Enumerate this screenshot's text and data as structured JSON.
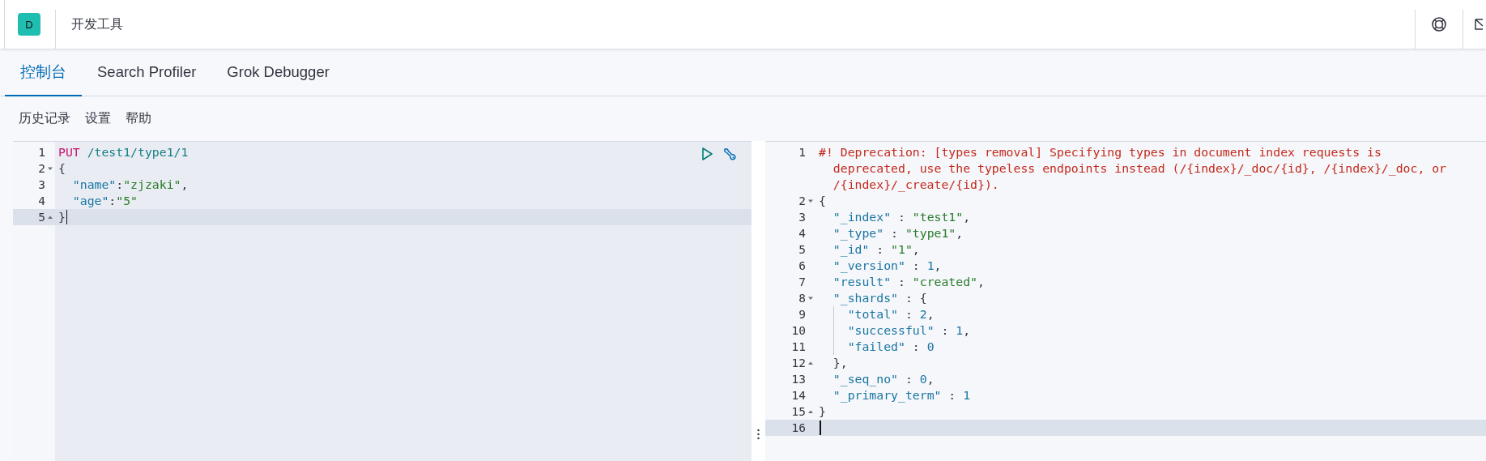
{
  "header": {
    "logo": "D",
    "title": "开发工具"
  },
  "tabs": [
    {
      "label": "控制台",
      "selected": true
    },
    {
      "label": "Search Profiler",
      "selected": false
    },
    {
      "label": "Grok Debugger",
      "selected": false
    }
  ],
  "menu": [
    "历史记录",
    "设置",
    "帮助"
  ],
  "request": {
    "lines": [
      {
        "number": "1",
        "fold_open": false,
        "fold_close": false,
        "active": false,
        "wrap": false,
        "guide": false,
        "tokens": [
          {
            "kind": "method",
            "text": "PUT"
          },
          {
            "kind": "url",
            "text": " /test1/type1/1"
          }
        ]
      },
      {
        "number": "2",
        "fold_open": true,
        "fold_close": false,
        "active": false,
        "wrap": false,
        "guide": false,
        "tokens": [
          {
            "kind": "punct",
            "text": "{"
          }
        ]
      },
      {
        "number": "3",
        "fold_open": false,
        "fold_close": false,
        "active": false,
        "wrap": false,
        "guide": false,
        "tokens": [
          {
            "kind": "key",
            "text": "  \"name\""
          },
          {
            "kind": "punct",
            "text": ":"
          },
          {
            "kind": "string",
            "text": "\"zjzaki\""
          },
          {
            "kind": "punct",
            "text": ","
          }
        ]
      },
      {
        "number": "4",
        "fold_open": false,
        "fold_close": false,
        "active": false,
        "wrap": false,
        "guide": false,
        "tokens": [
          {
            "kind": "key",
            "text": "  \"age\""
          },
          {
            "kind": "punct",
            "text": ":"
          },
          {
            "kind": "string",
            "text": "\"5\""
          }
        ]
      },
      {
        "number": "5",
        "fold_open": false,
        "fold_close": true,
        "active": true,
        "wrap": false,
        "guide": false,
        "tokens": [
          {
            "kind": "punct",
            "text": "}"
          }
        ]
      }
    ]
  },
  "response": {
    "lines": [
      {
        "number": "1",
        "fold_open": false,
        "fold_close": false,
        "active": false,
        "wrap": false,
        "guide": false,
        "tokens": [
          {
            "kind": "comment",
            "text": "#! Deprecation: [types removal] Specifying types in document index requests is"
          }
        ]
      },
      {
        "fold_open": false,
        "fold_close": false,
        "active": false,
        "wrap": true,
        "guide": false,
        "tokens": [
          {
            "kind": "comment",
            "text": "deprecated, use the typeless endpoints instead (/{index}/_doc/{id}, /{index}/_doc, or"
          }
        ]
      },
      {
        "fold_open": false,
        "fold_close": false,
        "active": false,
        "wrap": true,
        "guide": false,
        "tokens": [
          {
            "kind": "comment",
            "text": "/{index}/_create/{id})."
          }
        ]
      },
      {
        "number": "2",
        "fold_open": true,
        "fold_close": false,
        "active": false,
        "wrap": false,
        "guide": false,
        "tokens": [
          {
            "kind": "punct",
            "text": "{"
          }
        ]
      },
      {
        "number": "3",
        "fold_open": false,
        "fold_close": false,
        "active": false,
        "wrap": false,
        "guide": false,
        "tokens": [
          {
            "kind": "key",
            "text": "  \"_index\""
          },
          {
            "kind": "punct",
            "text": " : "
          },
          {
            "kind": "string",
            "text": "\"test1\""
          },
          {
            "kind": "punct",
            "text": ","
          }
        ]
      },
      {
        "number": "4",
        "fold_open": false,
        "fold_close": false,
        "active": false,
        "wrap": false,
        "guide": false,
        "tokens": [
          {
            "kind": "key",
            "text": "  \"_type\""
          },
          {
            "kind": "punct",
            "text": " : "
          },
          {
            "kind": "string",
            "text": "\"type1\""
          },
          {
            "kind": "punct",
            "text": ","
          }
        ]
      },
      {
        "number": "5",
        "fold_open": false,
        "fold_close": false,
        "active": false,
        "wrap": false,
        "guide": false,
        "tokens": [
          {
            "kind": "key",
            "text": "  \"_id\""
          },
          {
            "kind": "punct",
            "text": " : "
          },
          {
            "kind": "string",
            "text": "\"1\""
          },
          {
            "kind": "punct",
            "text": ","
          }
        ]
      },
      {
        "number": "6",
        "fold_open": false,
        "fold_close": false,
        "active": false,
        "wrap": false,
        "guide": false,
        "tokens": [
          {
            "kind": "key",
            "text": "  \"_version\""
          },
          {
            "kind": "punct",
            "text": " : "
          },
          {
            "kind": "number",
            "text": "1"
          },
          {
            "kind": "punct",
            "text": ","
          }
        ]
      },
      {
        "number": "7",
        "fold_open": false,
        "fold_close": false,
        "active": false,
        "wrap": false,
        "guide": false,
        "tokens": [
          {
            "kind": "key",
            "text": "  \"result\""
          },
          {
            "kind": "punct",
            "text": " : "
          },
          {
            "kind": "string",
            "text": "\"created\""
          },
          {
            "kind": "punct",
            "text": ","
          }
        ]
      },
      {
        "number": "8",
        "fold_open": true,
        "fold_close": false,
        "active": false,
        "wrap": false,
        "guide": false,
        "tokens": [
          {
            "kind": "key",
            "text": "  \"_shards\""
          },
          {
            "kind": "punct",
            "text": " : {"
          }
        ]
      },
      {
        "number": "9",
        "fold_open": false,
        "fold_close": false,
        "active": false,
        "wrap": false,
        "guide": true,
        "tokens": [
          {
            "kind": "key",
            "text": "    \"total\""
          },
          {
            "kind": "punct",
            "text": " : "
          },
          {
            "kind": "number",
            "text": "2"
          },
          {
            "kind": "punct",
            "text": ","
          }
        ]
      },
      {
        "number": "10",
        "fold_open": false,
        "fold_close": false,
        "active": false,
        "wrap": false,
        "guide": true,
        "tokens": [
          {
            "kind": "key",
            "text": "    \"successful\""
          },
          {
            "kind": "punct",
            "text": " : "
          },
          {
            "kind": "number",
            "text": "1"
          },
          {
            "kind": "punct",
            "text": ","
          }
        ]
      },
      {
        "number": "11",
        "fold_open": false,
        "fold_close": false,
        "active": false,
        "wrap": false,
        "guide": true,
        "tokens": [
          {
            "kind": "key",
            "text": "    \"failed\""
          },
          {
            "kind": "punct",
            "text": " : "
          },
          {
            "kind": "number",
            "text": "0"
          }
        ]
      },
      {
        "number": "12",
        "fold_open": false,
        "fold_close": true,
        "active": false,
        "wrap": false,
        "guide": false,
        "tokens": [
          {
            "kind": "punct",
            "text": "  },"
          }
        ]
      },
      {
        "number": "13",
        "fold_open": false,
        "fold_close": false,
        "active": false,
        "wrap": false,
        "guide": false,
        "tokens": [
          {
            "kind": "key",
            "text": "  \"_seq_no\""
          },
          {
            "kind": "punct",
            "text": " : "
          },
          {
            "kind": "number",
            "text": "0"
          },
          {
            "kind": "punct",
            "text": ","
          }
        ]
      },
      {
        "number": "14",
        "fold_open": false,
        "fold_close": false,
        "active": false,
        "wrap": false,
        "guide": false,
        "tokens": [
          {
            "kind": "key",
            "text": "  \"_primary_term\""
          },
          {
            "kind": "punct",
            "text": " : "
          },
          {
            "kind": "number",
            "text": "1"
          }
        ]
      },
      {
        "number": "15",
        "fold_open": false,
        "fold_close": true,
        "active": false,
        "wrap": false,
        "guide": false,
        "tokens": [
          {
            "kind": "punct",
            "text": "}"
          }
        ]
      },
      {
        "number": "16",
        "fold_open": false,
        "fold_close": false,
        "active": true,
        "wrap": false,
        "guide": false
      }
    ]
  }
}
